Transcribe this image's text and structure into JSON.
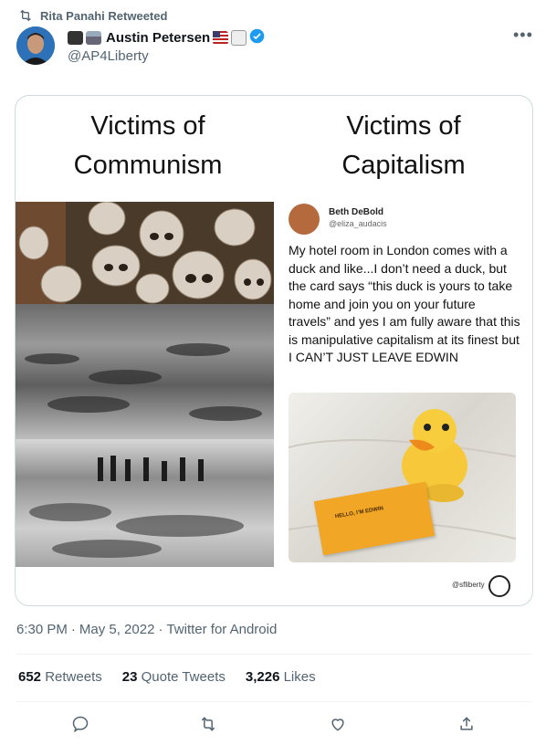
{
  "retweet_notice": "Rita Panahi Retweeted",
  "author": {
    "name": "Austin Petersen",
    "handle": "@AP4Liberty",
    "verified": true
  },
  "media": {
    "left_heading": "Victims of\nCommunism",
    "right_heading": "Victims of\nCapitalism",
    "embedded_tweet": {
      "name": "Beth DeBold",
      "handle": "@eliza_audacis",
      "text": "My hotel room in London comes with a duck and like...I don’t need a duck, but the card says “this duck is yours to take home and join you on your future travels” and yes I am fully aware that this is manipulative capitalism at its finest but I CAN’T JUST LEAVE EDWIN"
    },
    "card_text": "HELLO, I’M EDWIN",
    "watermark": "@sfliberty"
  },
  "meta": {
    "time": "6:30 PM",
    "date": "May 5, 2022",
    "source": "Twitter for Android",
    "sep": "·"
  },
  "stats": [
    {
      "count": "652",
      "label": "Retweets"
    },
    {
      "count": "23",
      "label": "Quote Tweets"
    },
    {
      "count": "3,226",
      "label": "Likes"
    }
  ],
  "colors": {
    "secondary_text": "#536471",
    "verified_blue": "#1d9bf0",
    "border": "#cfd9de"
  }
}
